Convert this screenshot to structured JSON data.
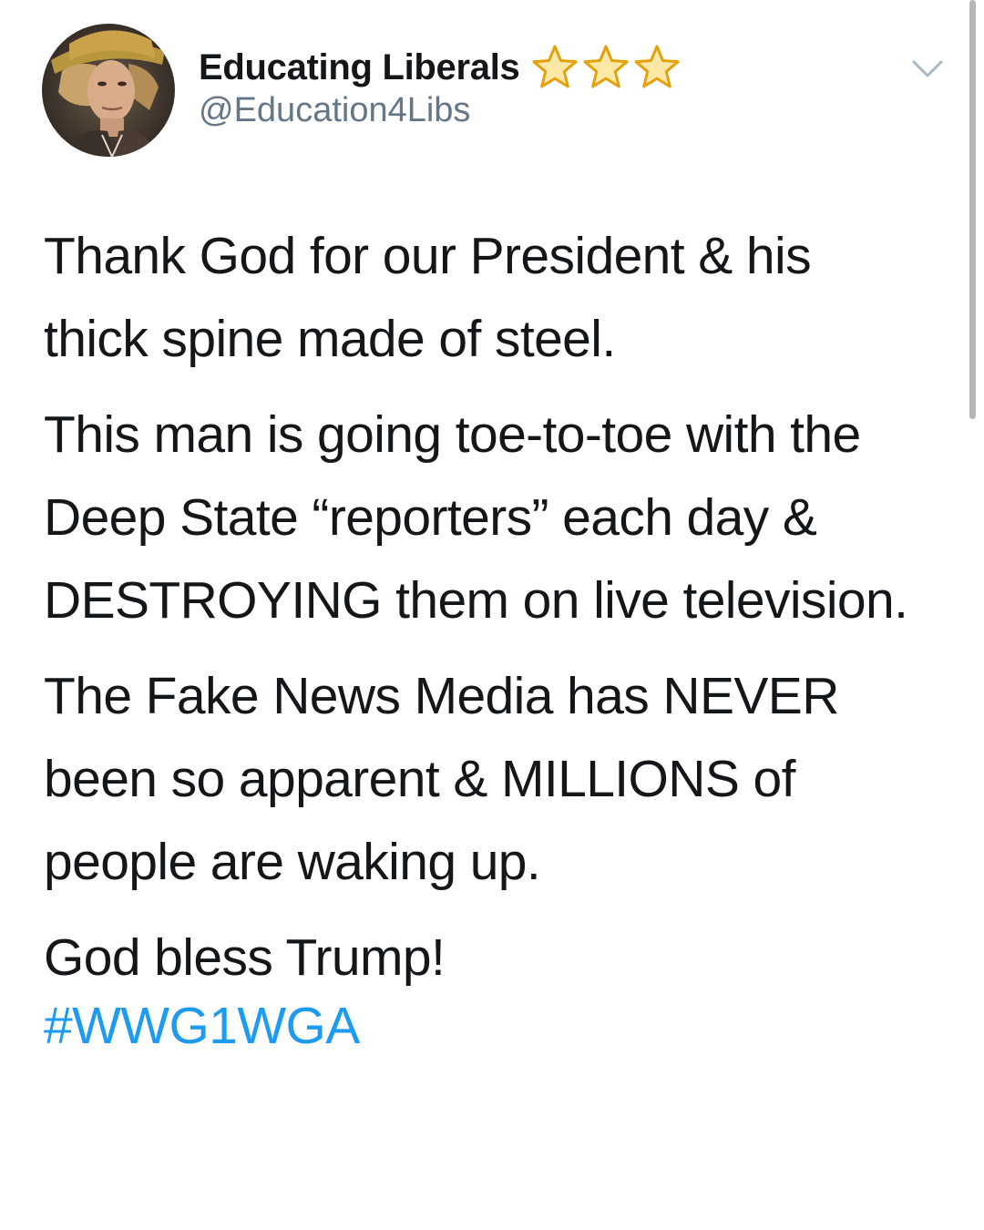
{
  "profile": {
    "display_name": "Educating Liberals",
    "handle": "@Education4Libs",
    "badge_icons": [
      "star-icon",
      "star-icon",
      "star-icon"
    ],
    "avatar_icon": "avatar-photo"
  },
  "header": {
    "menu_icon": "chevron-down-icon"
  },
  "tweet": {
    "paragraphs": [
      "Thank God for our President & his thick spine made of steel.",
      "This man is going toe-to-toe with the Deep State “reporters” each day & DESTROYING them on live television.",
      "The Fake News Media has NEVER been so apparent & MILLIONS of people are waking up.",
      "God bless Trump!"
    ],
    "hashtag": "#WWG1WGA"
  },
  "colors": {
    "text": "#14171a",
    "secondary": "#657786",
    "link": "#1d9bf0",
    "star": "#f5b50a"
  }
}
